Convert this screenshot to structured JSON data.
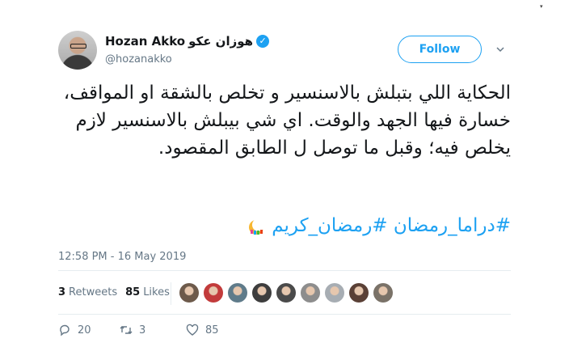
{
  "author": {
    "name": "Hozan Akko",
    "name_ar": "هوزان عكو",
    "verified_mark": "✓",
    "handle": "@hozanakko",
    "follow_label": "Follow"
  },
  "tweet": {
    "text": "الحكاية اللي بتبلش بالاسنسير و تخلص بالشقة او المواقف، خسارة فيها الجهد والوقت. اي شي بيبلش بالاسنسير لازم يخلص فيه؛ وقبل ما توصل ل الطابق المقصود.",
    "hashtags": [
      "#دراما_رمضان",
      "#رمضان_كريم"
    ],
    "timestamp": "12:58 PM - 16 May 2019"
  },
  "stats": {
    "retweets_count": "3",
    "retweets_label": "Retweets",
    "likes_count": "85",
    "likes_label": "Likes"
  },
  "likers": [
    {
      "icon": "avatar",
      "color": "#6d5a4b"
    },
    {
      "icon": "avatar",
      "color": "#c23b3b"
    },
    {
      "icon": "avatar",
      "color": "#5f7b8a"
    },
    {
      "icon": "avatar",
      "color": "#3d3d3d"
    },
    {
      "icon": "avatar",
      "color": "#4a4a4a"
    },
    {
      "icon": "avatar",
      "color": "#8d8d8d"
    },
    {
      "icon": "avatar",
      "color": "#a7adb3"
    },
    {
      "icon": "avatar",
      "color": "#5a4036"
    },
    {
      "icon": "avatar",
      "color": "#7a7268"
    }
  ],
  "actions": {
    "reply_count": "20",
    "retweet_count": "3",
    "like_count": "85"
  },
  "colors": {
    "accent": "#1da1f2",
    "text": "#14171a",
    "muted": "#657786"
  }
}
